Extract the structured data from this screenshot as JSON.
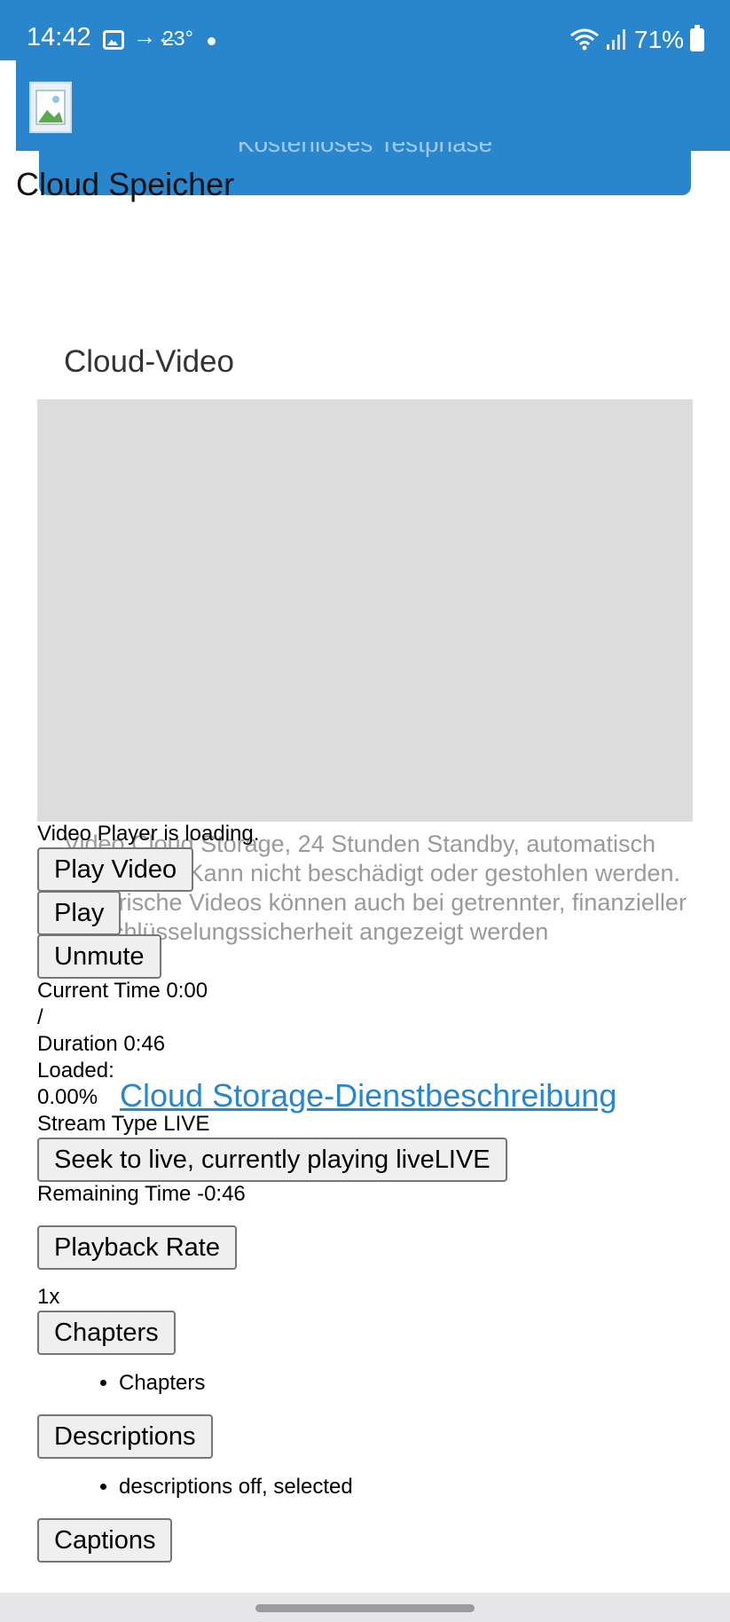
{
  "status_bar": {
    "time": "14:42",
    "arrows": "→←",
    "temperature": "23°",
    "battery_percent": "71%"
  },
  "header": {
    "ghost_text": "Kostenloses Testphase"
  },
  "page": {
    "title": "Cloud Speicher",
    "section_title": "Cloud-Video"
  },
  "description": "Video Cloud Storage, 24 Stunden Standby, automatisch hochladen. Kann nicht beschädigt oder gestohlen werden. Historische Videos können auch bei getrennter, finanzieller Verschlüsselungssicherheit angezeigt werden",
  "service_link": "Cloud Storage-Dienstbeschreibung",
  "player": {
    "loading_text": "Video Player is loading.",
    "play_video_label": "Play Video",
    "play_label": "Play",
    "unmute_label": "Unmute",
    "current_time": "Current Time 0:00",
    "separator": "/",
    "duration": "Duration 0:46",
    "loaded_label": "Loaded:",
    "loaded_value": "0.00%",
    "stream_type": "Stream Type LIVE",
    "seek_live_label": "Seek to live, currently playing liveLIVE",
    "remaining_time": "Remaining Time -0:46",
    "playback_rate_label": "Playback Rate",
    "playback_rate_value": "1x",
    "chapters_label": "Chapters",
    "chapters_item": "Chapters",
    "descriptions_label": "Descriptions",
    "descriptions_item": "descriptions off, selected",
    "captions_label": "Captions"
  },
  "colors": {
    "brand_blue": "#2a86cc",
    "video_placeholder": "#dcdcdc"
  }
}
